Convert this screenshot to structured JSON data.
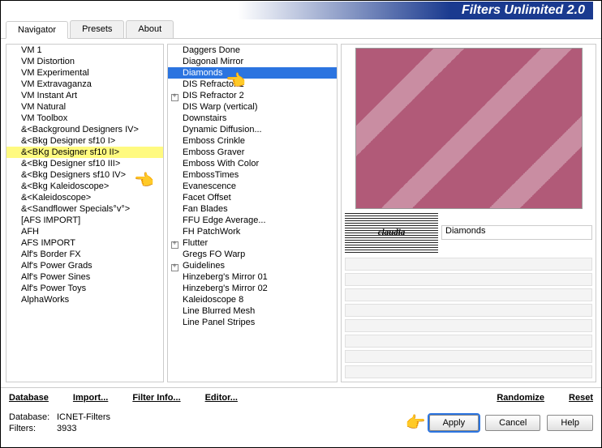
{
  "title": "Filters Unlimited 2.0",
  "tabs": [
    {
      "label": "Navigator",
      "active": true
    },
    {
      "label": "Presets",
      "active": false
    },
    {
      "label": "About",
      "active": false
    }
  ],
  "category_list": [
    {
      "label": "VM 1"
    },
    {
      "label": "VM Distortion"
    },
    {
      "label": "VM Experimental"
    },
    {
      "label": "VM Extravaganza"
    },
    {
      "label": "VM Instant Art"
    },
    {
      "label": "VM Natural"
    },
    {
      "label": "VM Toolbox"
    },
    {
      "label": "&<Background Designers IV>"
    },
    {
      "label": "&<Bkg Designer sf10 I>"
    },
    {
      "label": "&<BKg Designer sf10 II>",
      "highlighted": true
    },
    {
      "label": "&<Bkg Designer sf10 III>"
    },
    {
      "label": "&<Bkg Designers sf10 IV>"
    },
    {
      "label": "&<Bkg Kaleidoscope>"
    },
    {
      "label": "&<Kaleidoscope>"
    },
    {
      "label": "&<Sandflower Specials°v°>"
    },
    {
      "label": "[AFS IMPORT]"
    },
    {
      "label": "AFH"
    },
    {
      "label": "AFS IMPORT"
    },
    {
      "label": "Alf's Border FX"
    },
    {
      "label": "Alf's Power Grads"
    },
    {
      "label": "Alf's Power Sines"
    },
    {
      "label": "Alf's Power Toys"
    },
    {
      "label": "AlphaWorks"
    }
  ],
  "filter_list": [
    {
      "label": "Daggers Done"
    },
    {
      "label": "Diagonal Mirror"
    },
    {
      "label": "Diamonds",
      "selected": true
    },
    {
      "label": "DIS Refractor 1"
    },
    {
      "label": "DIS Refractor 2",
      "has_children": true
    },
    {
      "label": "DIS Warp (vertical)"
    },
    {
      "label": "Downstairs"
    },
    {
      "label": "Dynamic Diffusion..."
    },
    {
      "label": "Emboss Crinkle"
    },
    {
      "label": "Emboss Graver"
    },
    {
      "label": "Emboss With Color"
    },
    {
      "label": "EmbossTimes"
    },
    {
      "label": "Evanescence"
    },
    {
      "label": "Facet Offset"
    },
    {
      "label": "Fan Blades"
    },
    {
      "label": "FFU Edge Average..."
    },
    {
      "label": "FH PatchWork"
    },
    {
      "label": "Flutter",
      "has_children": true
    },
    {
      "label": "Gregs FO Warp"
    },
    {
      "label": "Guidelines",
      "has_children": true
    },
    {
      "label": "Hinzeberg's Mirror 01"
    },
    {
      "label": "Hinzeberg's Mirror 02"
    },
    {
      "label": "Kaleidoscope 8"
    },
    {
      "label": "Line Blurred Mesh"
    },
    {
      "label": "Line Panel Stripes"
    }
  ],
  "preset_name": "Diamonds",
  "logo_text": "claudia",
  "bottom_links": {
    "database": "Database",
    "import": "Import...",
    "filter_info": "Filter Info...",
    "editor": "Editor...",
    "randomize": "Randomize",
    "reset": "Reset"
  },
  "footer": {
    "db_label": "Database:",
    "db_value": "ICNET-Filters",
    "filters_label": "Filters:",
    "filters_value": "3933"
  },
  "buttons": {
    "apply": "Apply",
    "cancel": "Cancel",
    "help": "Help"
  }
}
